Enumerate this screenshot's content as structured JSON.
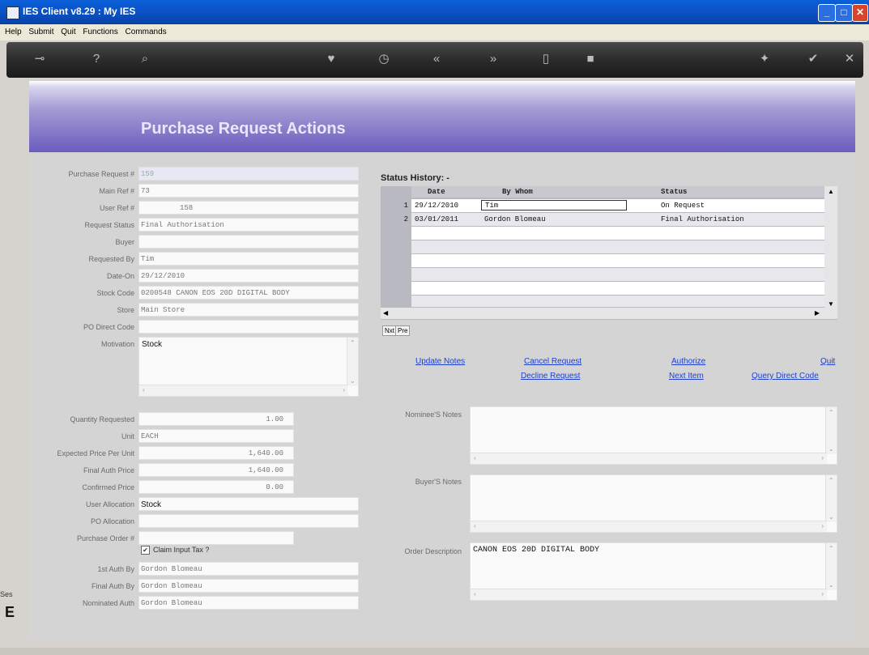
{
  "window": {
    "title": "IES Client v8.29 : My IES"
  },
  "menu": [
    "Help",
    "Submit",
    "Quit",
    "Functions",
    "Commands"
  ],
  "toolbar_icons": [
    "key-icon",
    "help-icon",
    "search-icon",
    "heart-icon",
    "clock-icon",
    "back-icon",
    "forward-icon",
    "document-icon",
    "stop-icon",
    "settings-icon",
    "check-icon",
    "close-icon"
  ],
  "page": {
    "heading": "Purchase Request Actions"
  },
  "sidebar": {
    "ses": "Ses",
    "letter": "E"
  },
  "left_form": [
    {
      "label": "Purchase Request #",
      "value": "159"
    },
    {
      "label": "Main Ref #",
      "value": "73"
    },
    {
      "label": "User Ref #",
      "value": "158"
    },
    {
      "label": "Request Status",
      "value": "Final Authorisation"
    },
    {
      "label": "Buyer",
      "value": ""
    },
    {
      "label": "Requested By",
      "value": "Tim"
    },
    {
      "label": "Date-On",
      "value": "29/12/2010"
    },
    {
      "label": "Stock Code",
      "value": "0200548 CANON EOS 20D DIGITAL BODY"
    },
    {
      "label": "Store",
      "value": "Main Store"
    },
    {
      "label": "PO Direct Code",
      "value": ""
    }
  ],
  "motivation": {
    "label": "Motivation",
    "value": "Stock"
  },
  "qty_form": [
    {
      "label": "Quantity Requested",
      "value": "1.00"
    },
    {
      "label": "Unit",
      "value": "EACH"
    },
    {
      "label": "Expected Price Per Unit",
      "value": "1,640.00"
    },
    {
      "label": "Final Auth Price",
      "value": "1,640.00"
    },
    {
      "label": "Confirmed Price",
      "value": "0.00"
    },
    {
      "label": "User Allocation",
      "value": "Stock"
    },
    {
      "label": "PO Allocation",
      "value": ""
    },
    {
      "label": "Purchase Order #",
      "value": ""
    }
  ],
  "claim_tax": {
    "label": "Claim Input Tax ?",
    "checked": "✔"
  },
  "auth_form": [
    {
      "label": "1st Auth By",
      "value": "Gordon Blomeau"
    },
    {
      "label": "Final Auth By",
      "value": "Gordon Blomeau"
    },
    {
      "label": "Nominated Auth",
      "value": "Gordon Blomeau"
    }
  ],
  "status_history": {
    "title": "Status History: -",
    "columns": [
      "Date",
      "By Whom",
      "Status"
    ],
    "rows": [
      {
        "n": "1",
        "date": "29/12/2010",
        "by": "Tim",
        "status": "On Request"
      },
      {
        "n": "2",
        "date": "03/01/2011",
        "by": "Gordon Blomeau",
        "status": "Final Authorisation"
      }
    ],
    "nav_next": "Nxt",
    "nav_prev": "Pre"
  },
  "actions": {
    "update_notes": "Update Notes",
    "cancel_request": "Cancel Request",
    "authorize": "Authorize",
    "quit": "Quit",
    "decline_request": "Decline Request",
    "next_item": "Next Item",
    "query_direct_code": "Query Direct Code"
  },
  "notes": [
    {
      "label": "Nominee'S Notes",
      "value": ""
    },
    {
      "label": "Buyer'S Notes",
      "value": ""
    },
    {
      "label": "Order Description",
      "value": "CANON EOS 20D DIGITAL BODY"
    }
  ]
}
